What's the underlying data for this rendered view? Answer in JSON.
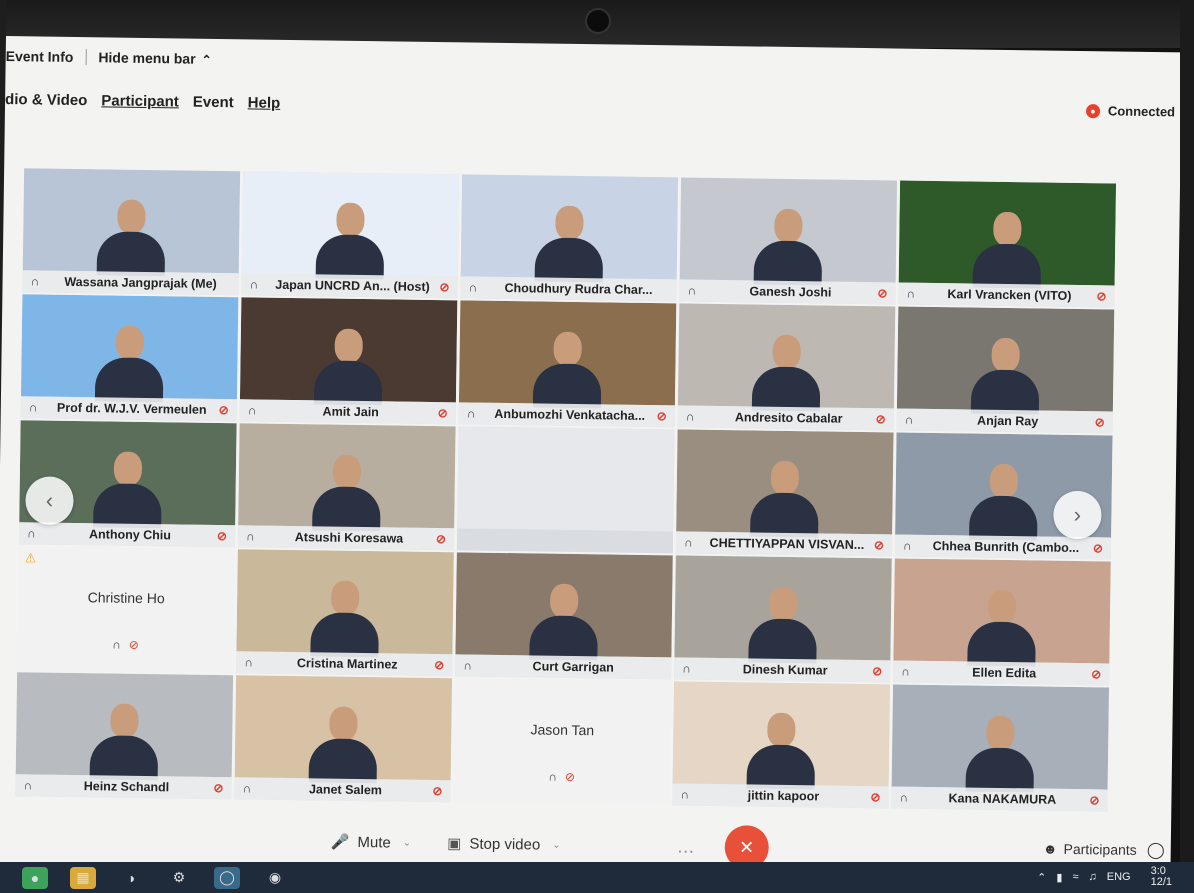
{
  "app": {
    "event_info": "Event Info",
    "hide_menu": "Hide menu bar",
    "status": "Connected"
  },
  "menu": [
    "dio & Video",
    "Participant",
    "Event",
    "Help"
  ],
  "tiles": [
    {
      "name": "Wassana Jangprajak (Me)",
      "bg": "#b7c5d6",
      "muted": false
    },
    {
      "name": "Japan UNCRD An... (Host)",
      "bg": "#e8eef7",
      "muted": true
    },
    {
      "name": "Choudhury Rudra Char...",
      "bg": "#c8d4e6",
      "muted": false
    },
    {
      "name": "Ganesh Joshi",
      "bg": "#c5c9cf",
      "muted": true
    },
    {
      "name": "Karl Vrancken (VITO)",
      "bg": "#2e5a2a",
      "muted": true
    },
    {
      "name": "Prof dr. W.J.V. Vermeulen",
      "bg": "#7fb6e8",
      "muted": true
    },
    {
      "name": "Amit Jain",
      "bg": "#4a3a32",
      "muted": true
    },
    {
      "name": "Anbumozhi Venkatacha...",
      "bg": "#8a6e4e",
      "muted": true
    },
    {
      "name": "Andresito Cabalar",
      "bg": "#bdb8b2",
      "muted": true
    },
    {
      "name": "Anjan Ray",
      "bg": "#7a7670",
      "muted": true
    },
    {
      "name": "Anthony Chiu",
      "bg": "#5b6e5a",
      "muted": true
    },
    {
      "name": "Atsushi Koresawa",
      "bg": "#b8aea0",
      "muted": true
    },
    {
      "name": "",
      "bg": "#e6e8ec",
      "muted": false
    },
    {
      "name": "CHETTIYAPPAN VISVAN...",
      "bg": "#9a8e80",
      "muted": true
    },
    {
      "name": "Chhea Bunrith (Cambo...",
      "bg": "#8e9aa8",
      "muted": true
    },
    {
      "name": "Christine Ho",
      "bg": "#f2f2f2",
      "muted": true,
      "blank": true
    },
    {
      "name": "Cristina Martinez",
      "bg": "#c9b89a",
      "muted": true
    },
    {
      "name": "Curt Garrigan",
      "bg": "#8a7a6c",
      "muted": false
    },
    {
      "name": "Dinesh Kumar",
      "bg": "#a8a49c",
      "muted": true
    },
    {
      "name": "Ellen Edita",
      "bg": "#c8a490",
      "muted": true
    },
    {
      "name": "Heinz Schandl",
      "bg": "#b8bcc0",
      "muted": true
    },
    {
      "name": "Janet Salem",
      "bg": "#d8c2a6",
      "muted": true
    },
    {
      "name": "Jason Tan",
      "bg": "#f2f2f2",
      "muted": true,
      "blank": true
    },
    {
      "name": "jittin kapoor",
      "bg": "#e6d6c6",
      "muted": true
    },
    {
      "name": "Kana NAKAMURA",
      "bg": "#a7afb8",
      "muted": true
    }
  ],
  "controls": {
    "mute": "Mute",
    "stop_video": "Stop video",
    "more": "…",
    "participants": "Participants"
  },
  "taskbar": {
    "lang": "ENG",
    "time": "3:0",
    "date": "12/1"
  }
}
